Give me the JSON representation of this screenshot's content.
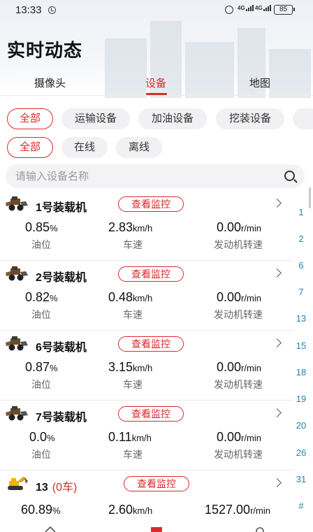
{
  "status_bar": {
    "time": "13:33",
    "network_1": "4G",
    "network_2": "4G",
    "battery": "85"
  },
  "page": {
    "title": "实时动态"
  },
  "tabs": [
    {
      "label": "摄像头",
      "active": false
    },
    {
      "label": "设备",
      "active": true
    },
    {
      "label": "地图",
      "active": false
    }
  ],
  "type_filters": [
    {
      "label": "全部",
      "active": true
    },
    {
      "label": "运输设备",
      "active": false
    },
    {
      "label": "加油设备",
      "active": false
    },
    {
      "label": "挖装设备",
      "active": false
    }
  ],
  "status_filters": [
    {
      "label": "全部",
      "active": true
    },
    {
      "label": "在线",
      "active": false
    },
    {
      "label": "离线",
      "active": false
    }
  ],
  "search": {
    "placeholder": "请输入设备名称"
  },
  "devices": [
    {
      "name": "1号装载机",
      "sub": "",
      "action": "查看监控",
      "icon": "loader-icon",
      "oil": "0.85",
      "oil_unit": "%",
      "oil_label": "油位",
      "speed": "2.83",
      "speed_unit": "km/h",
      "speed_label": "车速",
      "rpm": "0.00",
      "rpm_unit": "r/min",
      "rpm_label": "发动机转速"
    },
    {
      "name": "2号装载机",
      "sub": "",
      "action": "查看监控",
      "icon": "loader-icon",
      "oil": "0.82",
      "oil_unit": "%",
      "oil_label": "油位",
      "speed": "0.48",
      "speed_unit": "km/h",
      "speed_label": "车速",
      "rpm": "0.00",
      "rpm_unit": "r/min",
      "rpm_label": "发动机转速"
    },
    {
      "name": "6号装载机",
      "sub": "",
      "action": "查看监控",
      "icon": "loader-icon",
      "oil": "0.87",
      "oil_unit": "%",
      "oil_label": "油位",
      "speed": "3.15",
      "speed_unit": "km/h",
      "speed_label": "车速",
      "rpm": "0.00",
      "rpm_unit": "r/min",
      "rpm_label": "发动机转速"
    },
    {
      "name": "7号装载机",
      "sub": "",
      "action": "查看监控",
      "icon": "loader-icon",
      "oil": "0.0",
      "oil_unit": "%",
      "oil_label": "油位",
      "speed": "0.11",
      "speed_unit": "km/h",
      "speed_label": "车速",
      "rpm": "0.00",
      "rpm_unit": "r/min",
      "rpm_label": "发动机转速"
    },
    {
      "name": "13",
      "sub": "(0车)",
      "action": "查看监控",
      "icon": "excavator-icon",
      "oil": "60.89",
      "oil_unit": "%",
      "oil_label": "",
      "speed": "2.60",
      "speed_unit": "km/h",
      "speed_label": "",
      "rpm": "1527.00",
      "rpm_unit": "r/min",
      "rpm_label": ""
    }
  ],
  "index_bar": [
    "1",
    "2",
    "6",
    "7",
    "13",
    "15",
    "18",
    "19",
    "20",
    "26",
    "31",
    "#"
  ],
  "colors": {
    "accent": "#d92b2b",
    "index": "#2a7fb0"
  }
}
